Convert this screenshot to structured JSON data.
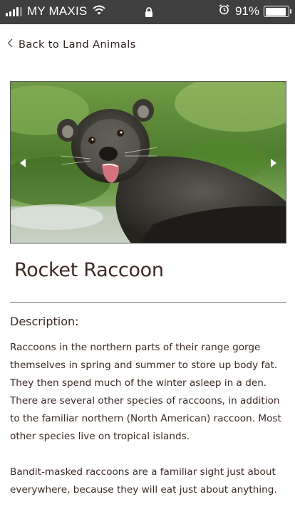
{
  "status_bar": {
    "carrier": "MY MAXIS",
    "battery_percent": "91%",
    "battery_level": 0.91,
    "signal_icon": "signal-bars-icon",
    "wifi_icon": "wifi-icon",
    "lock_icon": "lock-icon",
    "alarm_icon": "alarm-clock-icon"
  },
  "nav": {
    "back_label": "Back to Land Animals",
    "back_icon": "chevron-left-icon"
  },
  "carousel": {
    "prev_icon": "arrow-left-icon",
    "next_icon": "arrow-right-icon"
  },
  "animal": {
    "name": "Rocket Raccoon",
    "description_label": "Description:",
    "paragraphs": [
      "Raccoons in the northern parts of their range gorge themselves in spring and summer to store up body fat. They then spend much of the winter asleep in a den. There are several other species of raccoons, in addition to the familiar northern (North American) raccoon. Most other species live on tropical islands.",
      "Bandit-masked raccoons are a familiar sight just about everywhere, because they will eat just about anything."
    ]
  }
}
